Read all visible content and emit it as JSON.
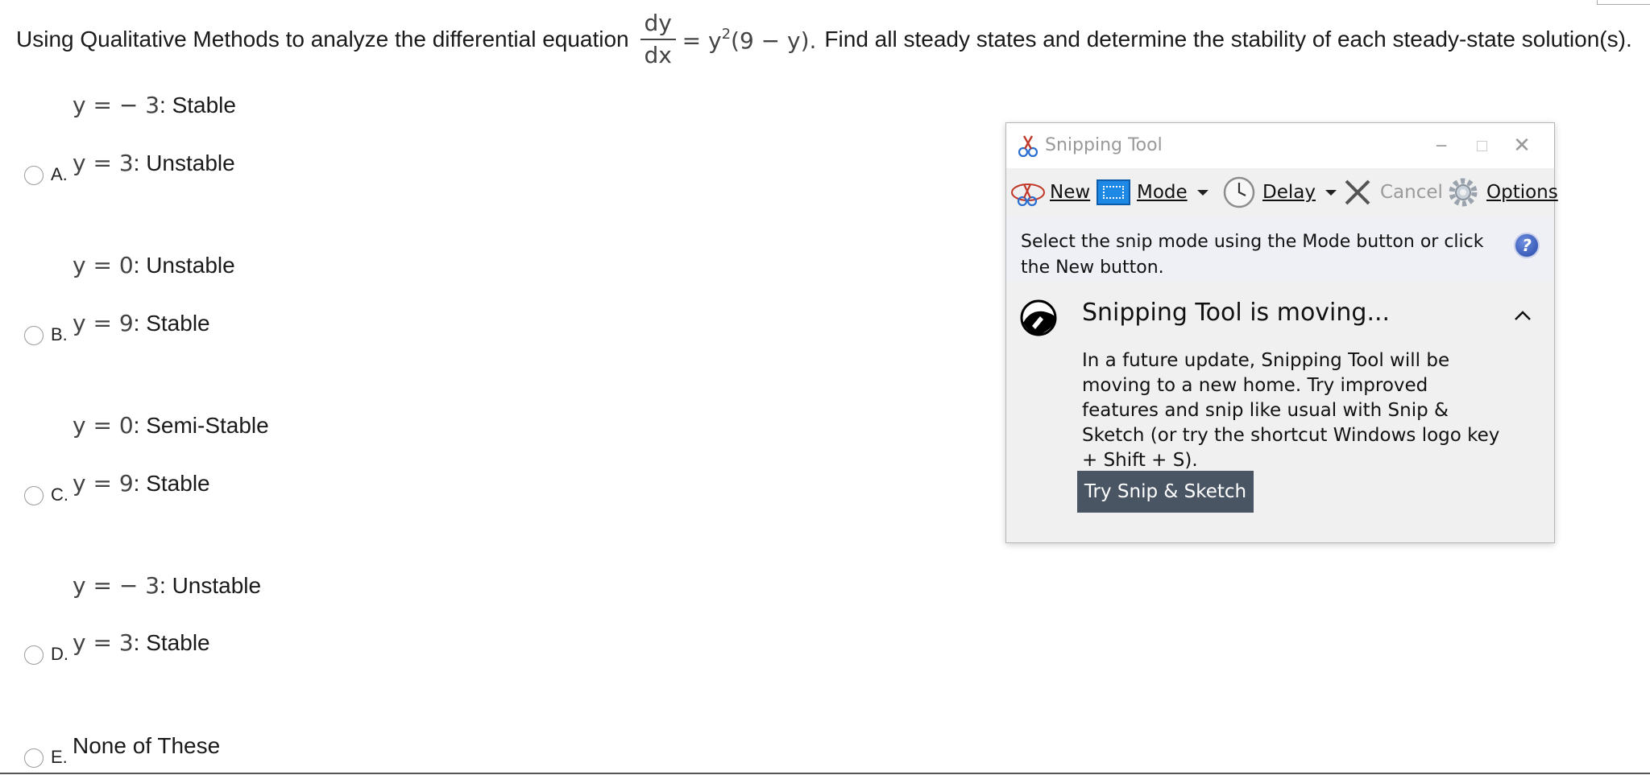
{
  "question": {
    "prefix": "Using Qualitative Methods to analyze the differential equation",
    "frac_num": "dy",
    "frac_den": "dx",
    "rhs_eq": "= y",
    "rhs_exp": "2",
    "rhs_rest": "(9 − y).",
    "suffix": "Find all steady states and determine the stability of each steady-state solution(s)."
  },
  "options": [
    {
      "letter": "A.",
      "line1_math": "y = − 3",
      "line1_text": ": Stable",
      "line2_math": "y = 3",
      "line2_text": ": Unstable"
    },
    {
      "letter": "B.",
      "line1_math": "y = 0",
      "line1_text": ": Unstable",
      "line2_math": "y = 9",
      "line2_text": ": Stable"
    },
    {
      "letter": "C.",
      "line1_math": "y = 0",
      "line1_text": ": Semi-Stable",
      "line2_math": "y = 9",
      "line2_text": ": Stable"
    },
    {
      "letter": "D.",
      "line1_math": "y = − 3",
      "line1_text": ": Unstable",
      "line2_math": "y = 3",
      "line2_text": ": Stable"
    },
    {
      "letter": "E.",
      "text": "None of These"
    }
  ],
  "snipping_tool": {
    "title": "Snipping Tool",
    "toolbar": {
      "new": "New",
      "mode": "Mode",
      "delay": "Delay",
      "cancel": "Cancel",
      "options": "Options"
    },
    "info_message": "Select the snip mode using the Mode button or click the New button.",
    "help_glyph": "?",
    "moving_title": "Snipping Tool is moving...",
    "moving_body": "In a future update, Snipping Tool will be moving to a new home. Try improved features and snip like usual with Snip & Sketch (or try the shortcut Windows logo key + Shift + S).",
    "try_button": "Try Snip & Sketch"
  },
  "colors": {
    "try_button_bg": "#4a5564",
    "info_bar_bg": "#eef0f6",
    "mode_icon": "#1e88e5"
  },
  "icons": [
    "scissors-icon",
    "mode-rectangle-icon",
    "clock-icon",
    "cancel-x-icon",
    "gear-icon",
    "help-icon",
    "snip-sketch-icon",
    "chevron-up-icon"
  ]
}
